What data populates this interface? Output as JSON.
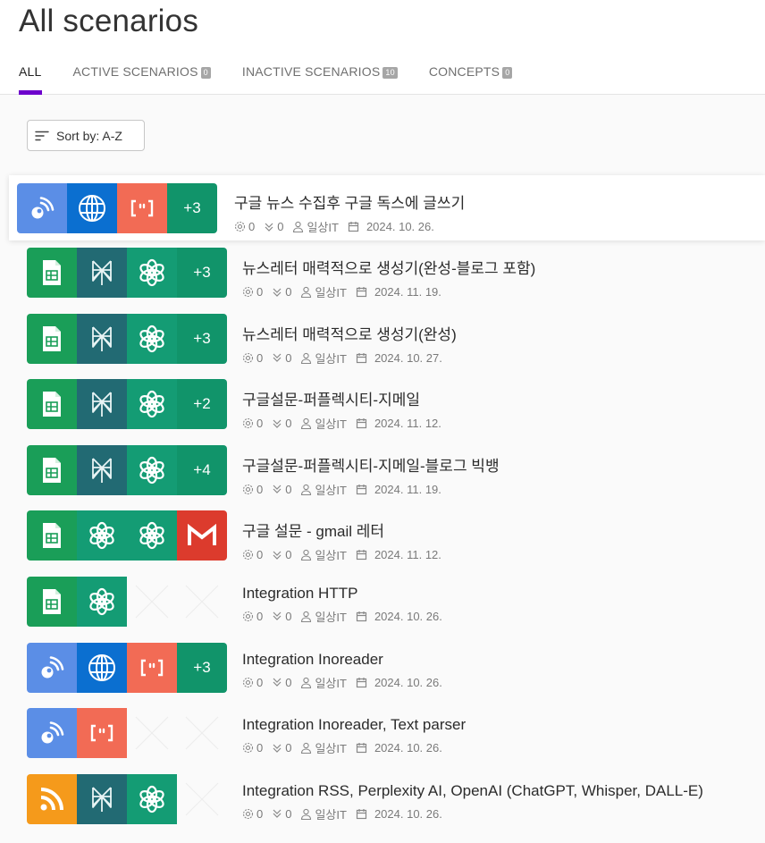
{
  "page": {
    "title": "All scenarios"
  },
  "tabs": [
    {
      "label": "ALL",
      "count": ""
    },
    {
      "label": "ACTIVE SCENARIOS",
      "count": "0"
    },
    {
      "label": "INACTIVE SCENARIOS",
      "count": "10"
    },
    {
      "label": "CONCEPTS",
      "count": "0"
    }
  ],
  "sort": {
    "label": "Sort by: A-Z"
  },
  "colors": {
    "accent": "#6d00cc",
    "rss_blue": "#5b8ee6",
    "http_blue": "#0b6fd0",
    "parser": "#f26b55",
    "more_green": "#11946a",
    "sheets": "#1a9e58",
    "perplexity": "#226a73",
    "openai": "#149c74",
    "gmail": "#dc3b2d",
    "rss_orange": "#f59a1b"
  },
  "scenarios": [
    {
      "name": "구글 뉴스 수집후 구글 독스에 글쓰기",
      "ops": "0",
      "transfer": "0",
      "owner": "일상IT",
      "date": "2024. 10. 26.",
      "icons": [
        "rss-blue",
        "http",
        "parser",
        "more"
      ],
      "more": "+3"
    },
    {
      "name": "뉴스레터 매력적으로 생성기(완성-블로그 포함)",
      "ops": "0",
      "transfer": "0",
      "owner": "일상IT",
      "date": "2024. 11. 19.",
      "icons": [
        "sheets",
        "perplexity",
        "openai",
        "more"
      ],
      "more": "+3"
    },
    {
      "name": "뉴스레터 매력적으로 생성기(완성)",
      "ops": "0",
      "transfer": "0",
      "owner": "일상IT",
      "date": "2024. 10. 27.",
      "icons": [
        "sheets",
        "perplexity",
        "openai",
        "more"
      ],
      "more": "+3"
    },
    {
      "name": "구글설문-퍼플렉시티-지메일",
      "ops": "0",
      "transfer": "0",
      "owner": "일상IT",
      "date": "2024. 11. 12.",
      "icons": [
        "sheets",
        "perplexity",
        "openai",
        "more"
      ],
      "more": "+2"
    },
    {
      "name": "구글설문-퍼플렉시티-지메일-블로그 빅뱅",
      "ops": "0",
      "transfer": "0",
      "owner": "일상IT",
      "date": "2024. 11. 19.",
      "icons": [
        "sheets",
        "perplexity",
        "openai",
        "more"
      ],
      "more": "+4"
    },
    {
      "name": "구글 설문 - gmail 레터",
      "ops": "0",
      "transfer": "0",
      "owner": "일상IT",
      "date": "2024. 11. 12.",
      "icons": [
        "sheets",
        "openai",
        "openai",
        "gmail"
      ],
      "more": ""
    },
    {
      "name": "Integration HTTP",
      "ops": "0",
      "transfer": "0",
      "owner": "일상IT",
      "date": "2024. 10. 26.",
      "icons": [
        "sheets",
        "openai",
        "empty",
        "empty"
      ],
      "more": ""
    },
    {
      "name": "Integration Inoreader",
      "ops": "0",
      "transfer": "0",
      "owner": "일상IT",
      "date": "2024. 10. 26.",
      "icons": [
        "rss-blue",
        "http",
        "parser",
        "more"
      ],
      "more": "+3"
    },
    {
      "name": "Integration Inoreader, Text parser",
      "ops": "0",
      "transfer": "0",
      "owner": "일상IT",
      "date": "2024. 10. 26.",
      "icons": [
        "rss-blue",
        "parser",
        "empty",
        "empty"
      ],
      "more": ""
    },
    {
      "name": "Integration RSS, Perplexity AI, OpenAI (ChatGPT, Whisper, DALL-E)",
      "ops": "0",
      "transfer": "0",
      "owner": "일상IT",
      "date": "2024. 10. 26.",
      "icons": [
        "rss-orange",
        "perplexity",
        "openai",
        "empty"
      ],
      "more": ""
    }
  ]
}
